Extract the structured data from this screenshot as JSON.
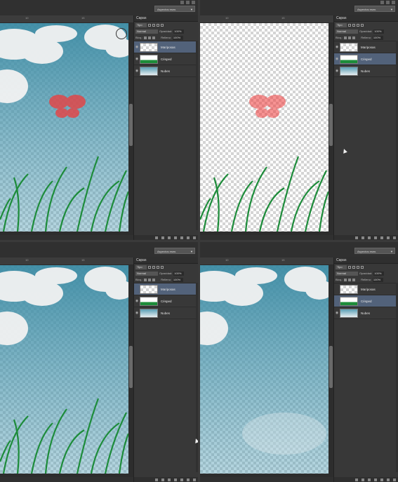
{
  "workspace": {
    "label": "Aspectos esen."
  },
  "layers_panel": {
    "tab": "Capas",
    "kind": "Tipo",
    "blend_mode": "Normal",
    "opacity_label": "Opacidad:",
    "opacity_value": "100%",
    "lock_label": "Bloq.:",
    "fill_label": "Relleno:",
    "fill_value": "100%",
    "layers": [
      {
        "name": "Mariposas"
      },
      {
        "name": "Césped"
      },
      {
        "name": "Nubes"
      }
    ]
  },
  "ruler": {
    "tick1": "10",
    "tick2": "15"
  },
  "colors": {
    "selection": "#52627a",
    "grass": "#1d8c3a",
    "sky": "#3d8ea6",
    "butterfly": "#f03a3a"
  }
}
